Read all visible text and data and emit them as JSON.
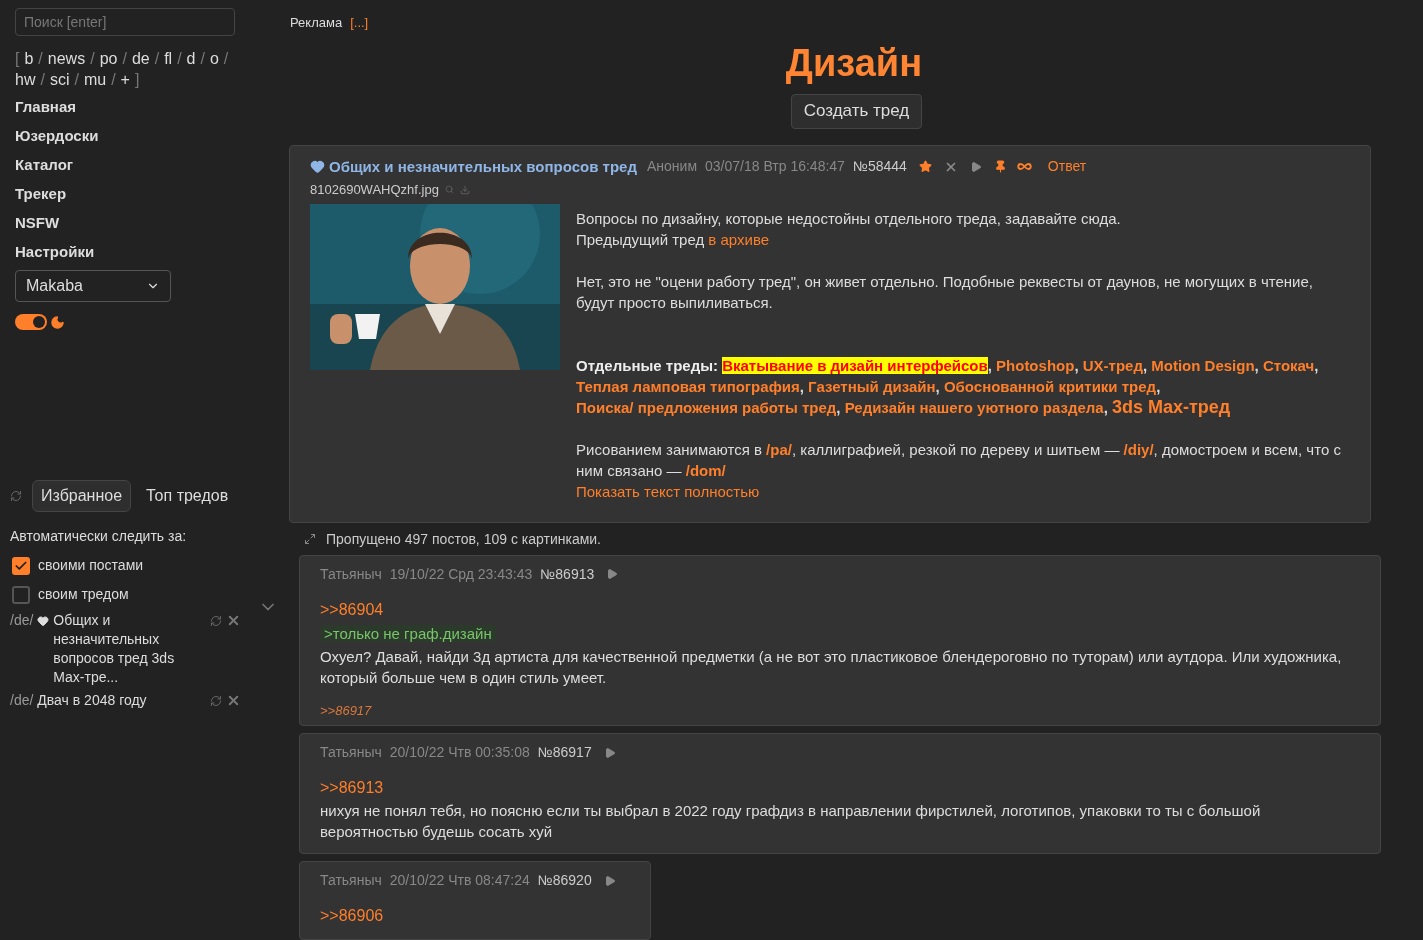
{
  "sidebar": {
    "search": {
      "placeholder": "Поиск [enter]"
    },
    "boards": [
      {
        "kind": "bracket",
        "text": "["
      },
      {
        "kind": "link",
        "text": "b"
      },
      {
        "kind": "sep",
        "text": "/"
      },
      {
        "kind": "link",
        "text": "news"
      },
      {
        "kind": "sep",
        "text": "/"
      },
      {
        "kind": "link",
        "text": "po"
      },
      {
        "kind": "sep",
        "text": "/"
      },
      {
        "kind": "link",
        "text": "de"
      },
      {
        "kind": "sep",
        "text": "/"
      },
      {
        "kind": "link",
        "text": "fl"
      },
      {
        "kind": "sep",
        "text": "/"
      },
      {
        "kind": "link",
        "text": "d"
      },
      {
        "kind": "sep",
        "text": "/"
      },
      {
        "kind": "link",
        "text": "o"
      },
      {
        "kind": "sep",
        "text": "/"
      },
      {
        "kind": "link",
        "text": "hw"
      },
      {
        "kind": "sep",
        "text": "/"
      },
      {
        "kind": "link",
        "text": "sci"
      },
      {
        "kind": "sep",
        "text": "/"
      },
      {
        "kind": "link",
        "text": "mu"
      },
      {
        "kind": "sep",
        "text": "/"
      },
      {
        "kind": "link",
        "text": "+"
      },
      {
        "kind": "bracket",
        "text": "]"
      }
    ],
    "nav": [
      "Главная",
      "Юзердоски",
      "Каталог",
      "Трекер",
      "NSFW",
      "Настройки"
    ],
    "style_select": {
      "value": "Makaba"
    },
    "night_mode": {
      "on": true
    },
    "tabs": [
      {
        "label": "Избранное",
        "selected": true
      },
      {
        "label": "Топ тредов",
        "selected": false
      }
    ],
    "auto_follow": {
      "label": "Автоматически следить за:",
      "options": [
        {
          "label": "своими постами",
          "checked": true
        },
        {
          "label": "своим тредом",
          "checked": false
        }
      ]
    },
    "favorites": [
      {
        "board": "/de/",
        "heart": true,
        "title": "Общих и незначительных вопросов тред 3ds Max-тре..."
      },
      {
        "board": "/de/",
        "heart": false,
        "title": "Двач в 2048 году"
      }
    ]
  },
  "ad": {
    "label": "Реклама",
    "link": "[...]"
  },
  "board_title": "Дизайн",
  "create_thread": "Создать тред",
  "op": {
    "title": "Общих и незначительных вопросов тред",
    "author": "Аноним",
    "date": "03/07/18 Втр 16:48:47",
    "number": "№58444",
    "reply": "Ответ",
    "file": "8102690WAHQzhf.jpg",
    "image": {
      "kind": "picture"
    },
    "paragraphs": [
      [
        {
          "kind": "text",
          "text": "Вопросы по дизайну, которые недостойны отдельного треда, задавайте сюда."
        }
      ],
      [
        {
          "kind": "text",
          "text": "Предыдущий тред "
        },
        {
          "kind": "link",
          "text": "в архиве"
        }
      ],
      [
        {
          "kind": "text",
          "text": "Нет, это не \"оцени работу тред\", он живет отдельно. Подобные реквесты от даунов, не могущих в чтение, будут просто выпиливаться."
        }
      ]
    ],
    "threads_label": "Отдельные треды:",
    "threads": [
      {
        "text": "Вкатывание в дизайн интерфейсов",
        "after": ",",
        "highlighted": true,
        "large": false
      },
      {
        "text": "Photoshop",
        "after": ",",
        "highlighted": false,
        "large": false
      },
      {
        "text": "UX-тред",
        "after": ",",
        "highlighted": false,
        "large": false
      },
      {
        "text": "Motion Design",
        "after": ",",
        "highlighted": false,
        "large": false
      },
      {
        "text": "Стокач",
        "after": ",",
        "highlighted": false,
        "large": false
      },
      {
        "text": "Теплая ламповая типография",
        "after": ",",
        "highlighted": false,
        "large": false
      },
      {
        "text": "Газетный дизайн",
        "after": ",",
        "highlighted": false,
        "large": false
      },
      {
        "text": "Обоснованной критики тред",
        "after": ",",
        "highlighted": false,
        "large": false
      },
      {
        "text": "Поиска/ предложения работы тред",
        "after": ",",
        "highlighted": false,
        "large": false
      },
      {
        "text": "Редизайн нашего уютного раздела",
        "after": ",",
        "highlighted": false,
        "large": false
      },
      {
        "text": "3ds Max-тред",
        "highlighted": false,
        "large": true
      }
    ],
    "closing": [
      {
        "kind": "text",
        "text": "Рисованием занимаются в "
      },
      {
        "kind": "board",
        "text": "/pa/"
      },
      {
        "kind": "text",
        "text": ", каллиграфией, резкой по дереву и шитьем — "
      },
      {
        "kind": "board",
        "text": "/diy/"
      },
      {
        "kind": "text",
        "text": ", домостроем и всем, что с ним связано — "
      },
      {
        "kind": "board",
        "text": "/dom/"
      }
    ],
    "show_full": "Показать текст полностью"
  },
  "omitted": "Пропущено 497 постов, 109 с картинками.",
  "replies": [
    {
      "author": "Татьяныч",
      "date": "19/10/22 Срд 23:43:43",
      "number": "№86913",
      "lines": [
        {
          "kind": "reply",
          "text": ">>86904"
        },
        {
          "kind": "quote",
          "text": ">только не граф.дизайн"
        },
        {
          "kind": "text",
          "text": "Охуел? Давай, найди 3д артиста для качественной предметки (а не вот это пластиковое блендероговно по туторам) или аутдора. Или художника, который больше чем в один стиль умеет."
        }
      ],
      "backlinks": [
        ">>86917"
      ]
    },
    {
      "author": "Татьяныч",
      "date": "20/10/22 Чтв 00:35:08",
      "number": "№86917",
      "lines": [
        {
          "kind": "reply",
          "text": ">>86913"
        },
        {
          "kind": "text",
          "text": "нихуя не понял тебя, но поясню если ты выбрал в 2022 году графдиз в направлении фирстилей, логотипов, упаковки то ты с большой вероятностью будешь сосать хуй"
        }
      ]
    },
    {
      "author": "Татьяныч",
      "date": "20/10/22 Чтв 08:47:24",
      "number": "№86920",
      "lines": [
        {
          "kind": "reply",
          "text": ">>86906"
        }
      ]
    }
  ]
}
